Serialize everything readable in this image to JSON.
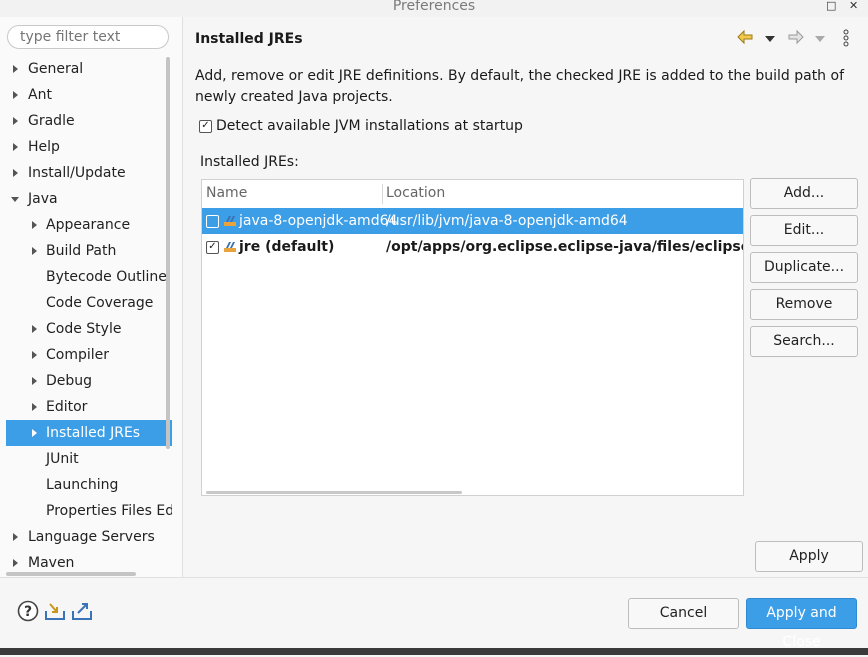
{
  "window": {
    "title": "Preferences"
  },
  "filter": {
    "placeholder": "type filter text"
  },
  "tree": [
    {
      "label": "General"
    },
    {
      "label": "Ant"
    },
    {
      "label": "Gradle"
    },
    {
      "label": "Help"
    },
    {
      "label": "Install/Update"
    },
    {
      "label": "Java"
    },
    {
      "label": "Appearance"
    },
    {
      "label": "Build Path"
    },
    {
      "label": "Bytecode Outline"
    },
    {
      "label": "Code Coverage"
    },
    {
      "label": "Code Style"
    },
    {
      "label": "Compiler"
    },
    {
      "label": "Debug"
    },
    {
      "label": "Editor"
    },
    {
      "label": "Installed JREs"
    },
    {
      "label": "JUnit"
    },
    {
      "label": "Launching"
    },
    {
      "label": "Properties Files Editor"
    },
    {
      "label": "Language Servers"
    },
    {
      "label": "Maven"
    }
  ],
  "page": {
    "title": "Installed JREs",
    "description": "Add, remove or edit JRE definitions. By default, the checked JRE is added to the build path of newly created Java projects.",
    "detect_label": "Detect available JVM installations at startup",
    "installed_label": "Installed JREs:",
    "columns": {
      "name": "Name",
      "location": "Location"
    },
    "rows": [
      {
        "name": "java-8-openjdk-amd64",
        "location": "/usr/lib/jvm/java-8-openjdk-amd64"
      },
      {
        "name": "jre (default)",
        "location": "/opt/apps/org.eclipse.eclipse-java/files/eclipse/plugins"
      }
    ],
    "buttons": {
      "add": "Add...",
      "edit": "Edit...",
      "duplicate": "Duplicate...",
      "remove": "Remove",
      "search": "Search...",
      "apply": "Apply"
    }
  },
  "footer": {
    "cancel": "Cancel",
    "apply_close": "Apply and Close"
  },
  "colors": {
    "accent": "#3d9ee8"
  }
}
